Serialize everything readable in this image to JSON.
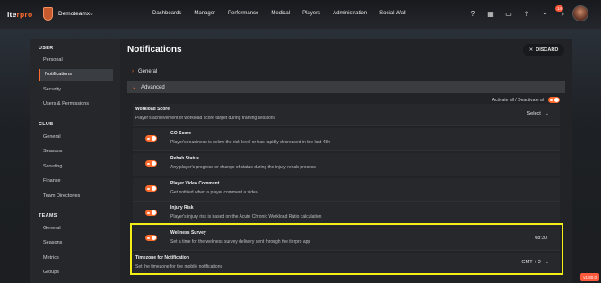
{
  "header": {
    "logo_prefix": "ite",
    "logo_suffix": "rpro",
    "team": "Demoteamx",
    "nav": [
      "Dashboards",
      "Manager",
      "Performance",
      "Medical",
      "Players",
      "Administration",
      "Social Wall"
    ],
    "notification_count": "14",
    "icons": [
      "help-icon",
      "calendar-icon",
      "folder-icon",
      "upload-icon",
      "chat-icon",
      "bell-icon"
    ]
  },
  "sidebar": {
    "user_title": "USER",
    "user_items": [
      "Personal",
      "Notifications",
      "Security",
      "Users & Permissions"
    ],
    "club_title": "CLUB",
    "club_items": [
      "General",
      "Seasons",
      "Scouting",
      "Finance",
      "Team Directories"
    ],
    "teams_title": "TEAMS",
    "teams_items": [
      "General",
      "Seasons",
      "Metrics",
      "Groups"
    ]
  },
  "main": {
    "title": "Notifications",
    "discard": "DISCARD",
    "sections": [
      "General",
      "Advanced"
    ],
    "activate_all": "Activate all / Deactivate all",
    "workload": {
      "title": "Workload Score",
      "desc": "Player's achievement of workload score target during training sessions",
      "select": "Select"
    },
    "items": [
      {
        "title": "GO Score",
        "desc": "Player's readiness is below the risk level or has rapidly decreased in the last 48h"
      },
      {
        "title": "Rehab Status",
        "desc": "Any player's progress or change of status during the injury rehab process"
      },
      {
        "title": "Player Video Comment",
        "desc": "Get notified when a player comment a video"
      },
      {
        "title": "Injury Risk",
        "desc": "Player's injury risk is based on the Acute Chronic Workload Ratio calculation"
      },
      {
        "title": "Wellness Survey",
        "desc": "Set a time for the wellness survey delivery sent through the iterpro app",
        "value": "08:30"
      }
    ],
    "timezone": {
      "title": "Timezone for Notification",
      "desc": "Set the timezone for the mobile notifications",
      "value": "GMT + 2"
    }
  },
  "version": "v1.80.0",
  "colors": {
    "accent": "#ff6b2c",
    "highlight": "#f3ee16"
  }
}
